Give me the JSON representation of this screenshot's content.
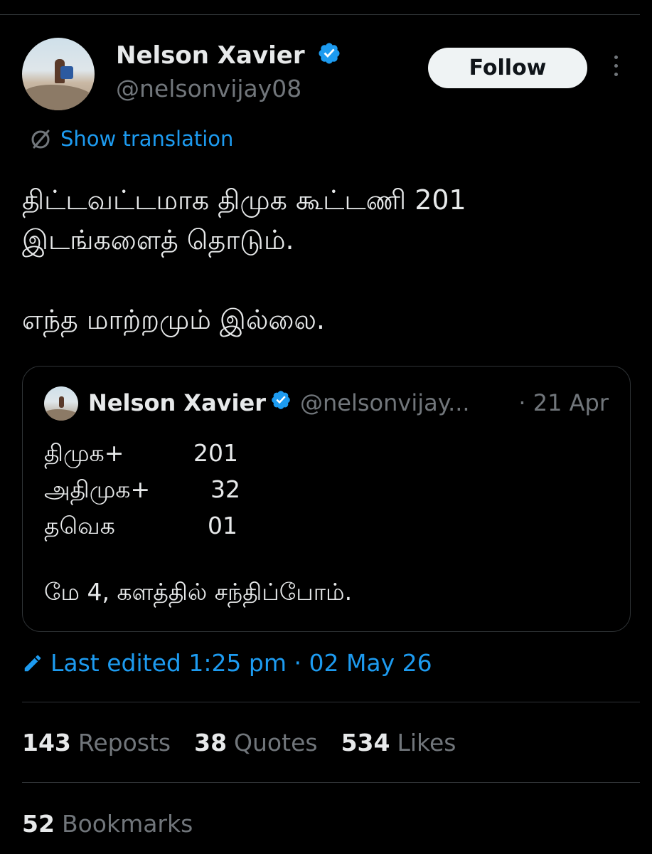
{
  "author": {
    "name": "Nelson Xavier",
    "handle": "@nelsonvijay08"
  },
  "follow_label": "Follow",
  "translation_label": "Show translation",
  "tweet": {
    "line1": "திட்டவட்டமாக திமுக கூட்டணி 201",
    "line2": "இடங்களைத் தொடும்.",
    "line3": "எந்த மாற்றமும் இல்லை."
  },
  "quoted": {
    "name": "Nelson Xavier",
    "handle": "@nelsonvijay...",
    "date": "· 21 Apr",
    "rows": [
      {
        "label": "திமுக+",
        "value": "201"
      },
      {
        "label": "அதிமுக+",
        "value": "32"
      },
      {
        "label": "தவெக",
        "value": "01"
      }
    ],
    "footer": "மே 4,  களத்தில் சந்திப்போம்."
  },
  "edited": "Last edited 1:25 pm · 02 May 26",
  "stats": [
    {
      "num": "143",
      "label": "Reposts"
    },
    {
      "num": "38",
      "label": "Quotes"
    },
    {
      "num": "534",
      "label": "Likes"
    }
  ],
  "bookmarks": {
    "num": "52",
    "label": "Bookmarks"
  },
  "colors": {
    "background": "#000000",
    "text": "#e7e9ea",
    "secondary": "#71767b",
    "accent": "#1d9bf0",
    "border": "#2f3336"
  }
}
